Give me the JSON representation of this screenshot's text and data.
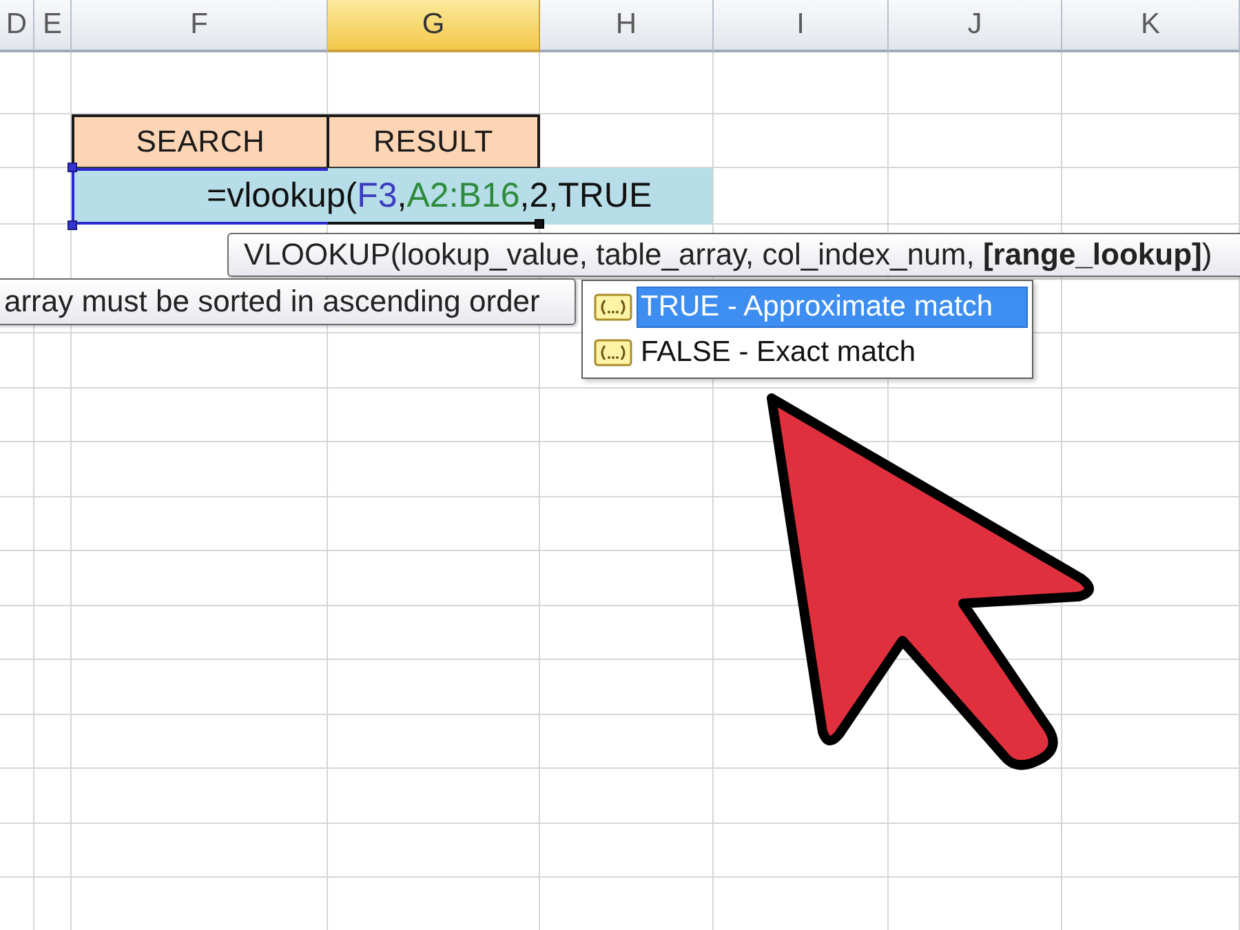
{
  "columns": [
    {
      "label": "D",
      "selected": false
    },
    {
      "label": "E",
      "selected": false
    },
    {
      "label": "F",
      "selected": false
    },
    {
      "label": "G",
      "selected": true
    },
    {
      "label": "H",
      "selected": false
    },
    {
      "label": "I",
      "selected": false
    },
    {
      "label": "J",
      "selected": false
    },
    {
      "label": "K",
      "selected": false
    }
  ],
  "table": {
    "headers": [
      "SEARCH",
      "RESULT"
    ]
  },
  "formula": {
    "parts": [
      {
        "kind": "text",
        "text": "=vlookup("
      },
      {
        "kind": "ref",
        "text": "F3",
        "color": "#3b3bc0"
      },
      {
        "kind": "text",
        "text": ","
      },
      {
        "kind": "ref",
        "text": "A2:B16",
        "color": "#2e8b3c"
      },
      {
        "kind": "text",
        "text": ",2,TRUE"
      }
    ]
  },
  "signature_tooltip": {
    "text": "VLOOKUP(lookup_value, table_array, col_index_num, **[range_lookup]**)"
  },
  "hint_tooltip": {
    "text": "array must be sorted in ascending order"
  },
  "autocomplete": {
    "items": [
      {
        "label": "TRUE - Approximate match",
        "selected": true
      },
      {
        "label": "FALSE - Exact match",
        "selected": false
      }
    ]
  }
}
